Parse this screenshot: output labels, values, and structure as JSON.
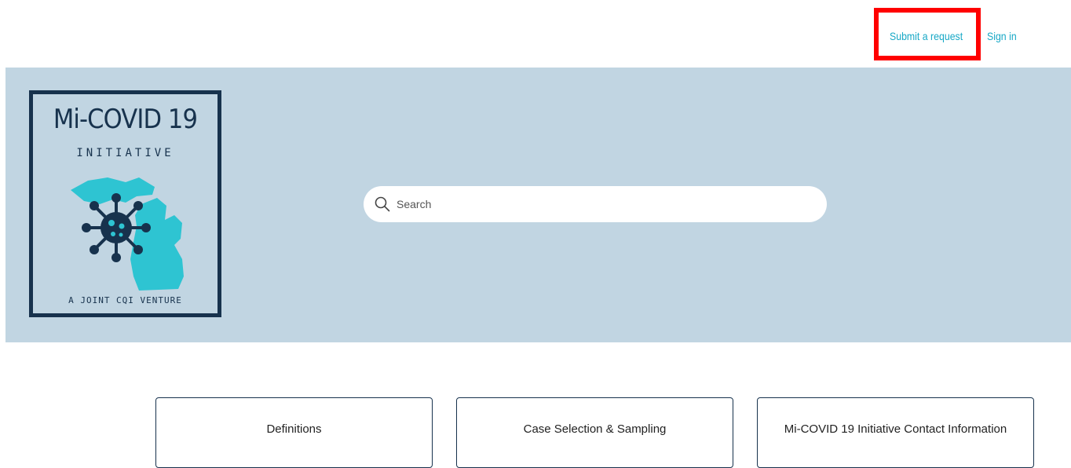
{
  "header": {
    "submit_request_label": "Submit a request",
    "sign_in_label": "Sign in",
    "link_color": "#17a8c6",
    "highlight_color": "#ff0000"
  },
  "hero": {
    "background_color": "#c1d5e2",
    "logo": {
      "title": "Mi-COVID 19",
      "subtitle": "INITIATIVE",
      "footer": "A JOINT CQI VENTURE",
      "icon": "michigan-virus-icon",
      "primary_color": "#17324d",
      "accent_color": "#2ec4d2"
    }
  },
  "search": {
    "placeholder": "Search",
    "value": "",
    "icon": "search-icon"
  },
  "categories": [
    {
      "label": "Definitions"
    },
    {
      "label": "Case Selection & Sampling"
    },
    {
      "label": "Mi-COVID 19 Initiative Contact Information"
    }
  ]
}
